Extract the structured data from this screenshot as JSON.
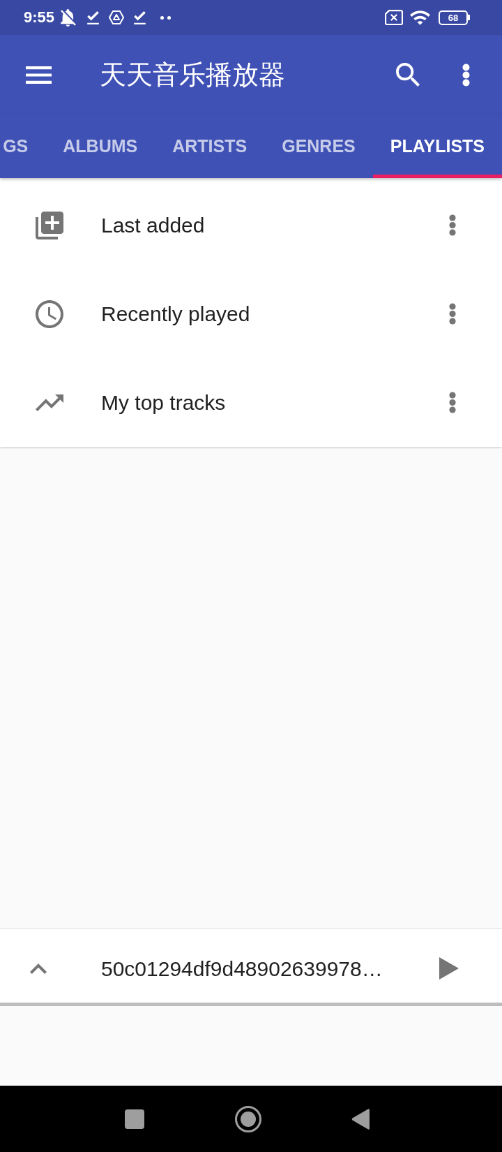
{
  "status_bar": {
    "time": "9:55",
    "battery": "68"
  },
  "app_bar": {
    "title": "天天音乐播放器"
  },
  "tabs": [
    {
      "label": "GS",
      "selected": false
    },
    {
      "label": "ALBUMS",
      "selected": false
    },
    {
      "label": "ARTISTS",
      "selected": false
    },
    {
      "label": "GENRES",
      "selected": false
    },
    {
      "label": "PLAYLISTS",
      "selected": true
    }
  ],
  "playlists": [
    {
      "kind": "last_added",
      "label": "Last added"
    },
    {
      "kind": "recent",
      "label": "Recently played"
    },
    {
      "kind": "top",
      "label": "My top tracks"
    }
  ],
  "mini_player": {
    "title": "50c01294df9d48902639978…",
    "playing": false
  }
}
